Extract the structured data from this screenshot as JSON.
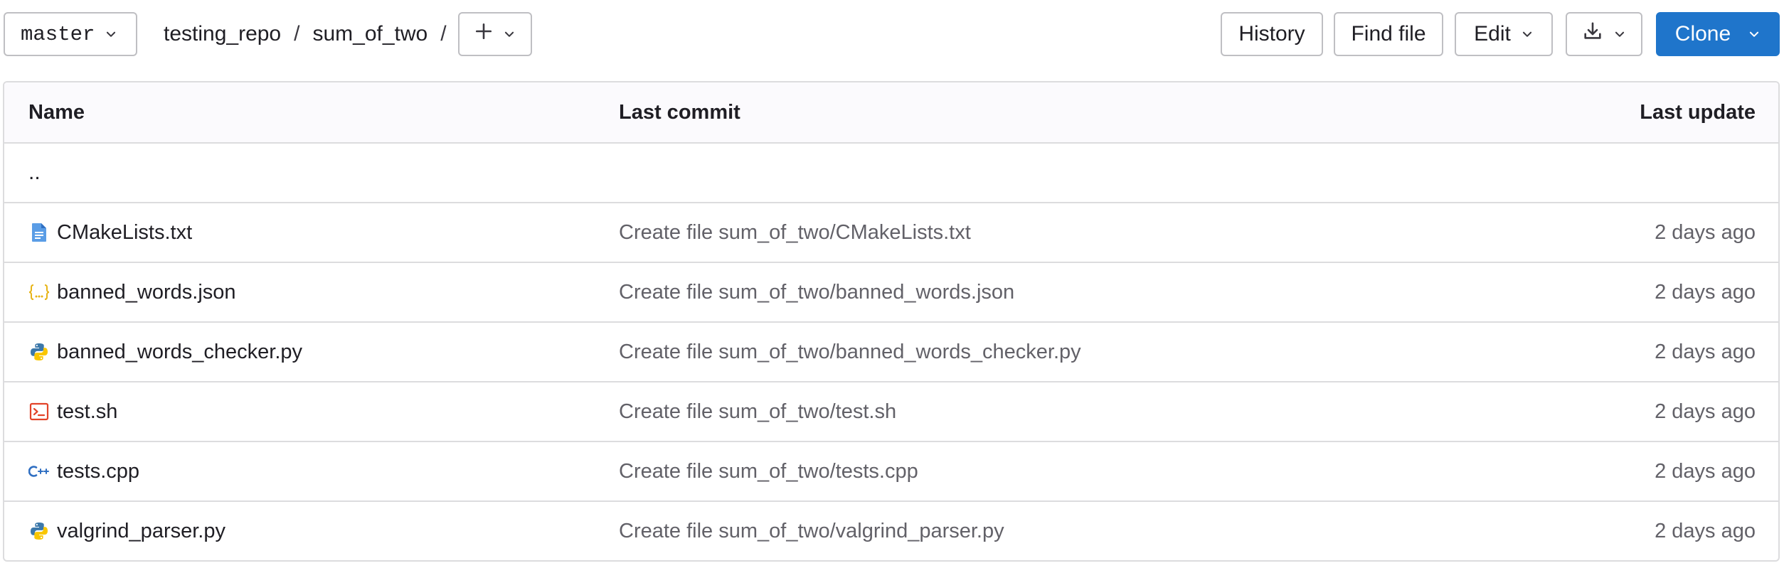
{
  "branch": {
    "name": "master"
  },
  "breadcrumb": {
    "items": [
      "testing_repo",
      "sum_of_two"
    ],
    "separator": "/"
  },
  "actions": {
    "history_label": "History",
    "find_file_label": "Find file",
    "edit_label": "Edit",
    "clone_label": "Clone"
  },
  "colors": {
    "primary": "#1f75cb",
    "border": "#dcdcde",
    "muted_text": "#626168"
  },
  "table": {
    "headers": {
      "name": "Name",
      "last_commit": "Last commit",
      "last_update": "Last update"
    },
    "parent_link": "..",
    "rows": [
      {
        "name": "CMakeLists.txt",
        "icon": "text-file-icon",
        "commit": "Create file sum_of_two/CMakeLists.txt",
        "updated": "2 days ago"
      },
      {
        "name": "banned_words.json",
        "icon": "json-file-icon",
        "commit": "Create file sum_of_two/banned_words.json",
        "updated": "2 days ago"
      },
      {
        "name": "banned_words_checker.py",
        "icon": "python-file-icon",
        "commit": "Create file sum_of_two/banned_words_checker.py",
        "updated": "2 days ago"
      },
      {
        "name": "test.sh",
        "icon": "shell-file-icon",
        "commit": "Create file sum_of_two/test.sh",
        "updated": "2 days ago"
      },
      {
        "name": "tests.cpp",
        "icon": "cpp-file-icon",
        "commit": "Create file sum_of_two/tests.cpp",
        "updated": "2 days ago"
      },
      {
        "name": "valgrind_parser.py",
        "icon": "python-file-icon",
        "commit": "Create file sum_of_two/valgrind_parser.py",
        "updated": "2 days ago"
      }
    ]
  }
}
